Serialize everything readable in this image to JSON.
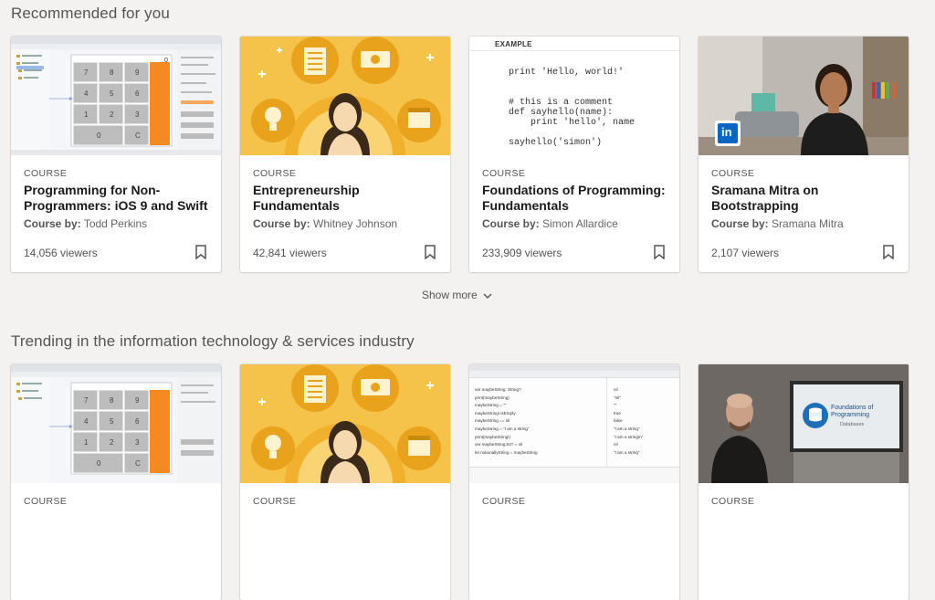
{
  "sections": [
    {
      "title": "Recommended for you",
      "cards": [
        {
          "kicker": "COURSE",
          "title": "Programming for Non-Programmers: iOS 9 and Swift",
          "author_label": "Course by:",
          "author": "Todd Perkins",
          "viewers": "14,056 viewers",
          "thumb": "xcode",
          "thumb_keys": [
            "7",
            "8",
            "9",
            "4",
            "5",
            "6",
            "1",
            "2",
            "3",
            "0",
            "C"
          ],
          "thumb_display": "0"
        },
        {
          "kicker": "COURSE",
          "title": "Entrepreneurship Fundamentals",
          "author_label": "Course by:",
          "author": "Whitney Johnson",
          "viewers": "42,841 viewers",
          "thumb": "entrepreneur"
        },
        {
          "kicker": "COURSE",
          "title": "Foundations of Programming: Fundamentals",
          "author_label": "Course by:",
          "author": "Simon Allardice",
          "viewers": "233,909 viewers",
          "thumb": "code",
          "thumb_label": "EXAMPLE",
          "thumb_lines": [
            "print 'Hello, world!'",
            "",
            "",
            "# this is a comment",
            "def sayhello(name):",
            "    print 'hello', name",
            "",
            "sayhello('simon')"
          ]
        },
        {
          "kicker": "COURSE",
          "title": "Sramana Mitra on Bootstrapping",
          "author_label": "Course by:",
          "author": "Sramana Mitra",
          "viewers": "2,107 viewers",
          "thumb": "photo",
          "thumb_badge": "in"
        }
      ]
    },
    {
      "title": "Trending in the information technology & services industry",
      "cards": [
        {
          "kicker": "COURSE",
          "thumb": "xcode",
          "thumb_keys": [
            "7",
            "8",
            "9",
            "4",
            "5",
            "6",
            "1",
            "2",
            "3",
            "0",
            "C"
          ]
        },
        {
          "kicker": "COURSE",
          "thumb": "entrepreneur"
        },
        {
          "kicker": "COURSE",
          "thumb": "swift",
          "thumb_lines": [
            "var maybeString: String?",
            "print(maybeString)",
            "maybeString = \"\"",
            "maybeString!.isEmpty",
            "maybeString == nil",
            "maybeString = \"I am a string\"",
            "print(maybeString!)",
            "var maybeString:Int? = nil",
            "let notionallyString = maybeString"
          ],
          "thumb_results": [
            "nil",
            "\"nil\"",
            "\"\"",
            "true",
            "false",
            "\"I am a string\"",
            "\"I am a string\\n\"",
            "nil",
            "\"I am a string\""
          ]
        },
        {
          "kicker": "COURSE",
          "thumb": "video",
          "thumb_screen_title": "Foundations of Programming",
          "thumb_screen_sub": "Databases"
        }
      ]
    }
  ],
  "show_more": "Show more",
  "colors": {
    "orange": "#f58a23",
    "yellow": "#f6c34a",
    "linkedin": "#0a66c2"
  }
}
